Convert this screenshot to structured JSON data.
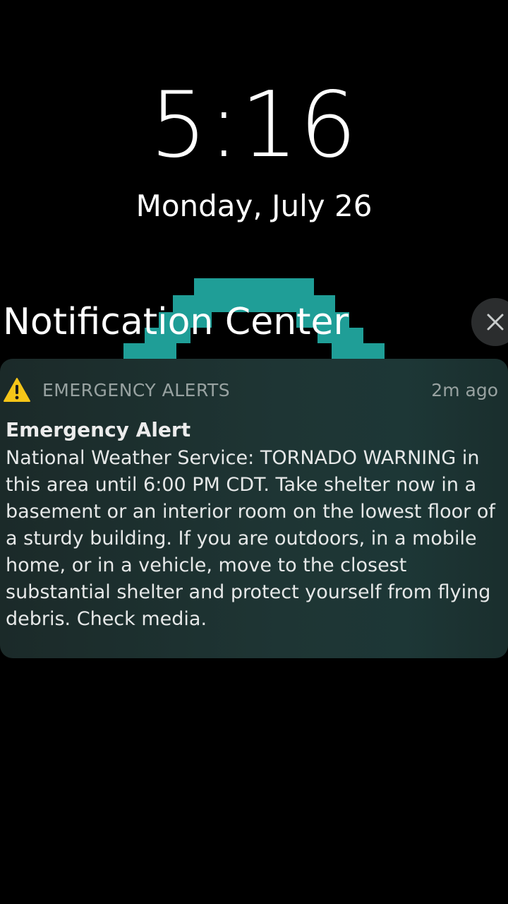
{
  "lockscreen": {
    "time": "5:16",
    "date": "Monday, July 26"
  },
  "notification_center": {
    "title": "Notification Center",
    "close_icon": "close-icon"
  },
  "notification": {
    "app_icon": "warning-triangle-icon",
    "app_name": "EMERGENCY ALERTS",
    "time_ago": "2m ago",
    "title": "Emergency Alert",
    "body": "National Weather Service: TORNADO WARNING in this area until 6:00 PM CDT. Take shelter now in a basement or an interior room on the lowest floor of a sturdy building. If you are outdoors, in a mobile home, or in a vehicle, move to the closest substantial shelter and protect yourself from flying debris. Check media."
  },
  "colors": {
    "background": "#000000",
    "wallpaper_accent": "#1f9e97",
    "card_background": "#1e3534",
    "warning_yellow": "#f5c518"
  }
}
